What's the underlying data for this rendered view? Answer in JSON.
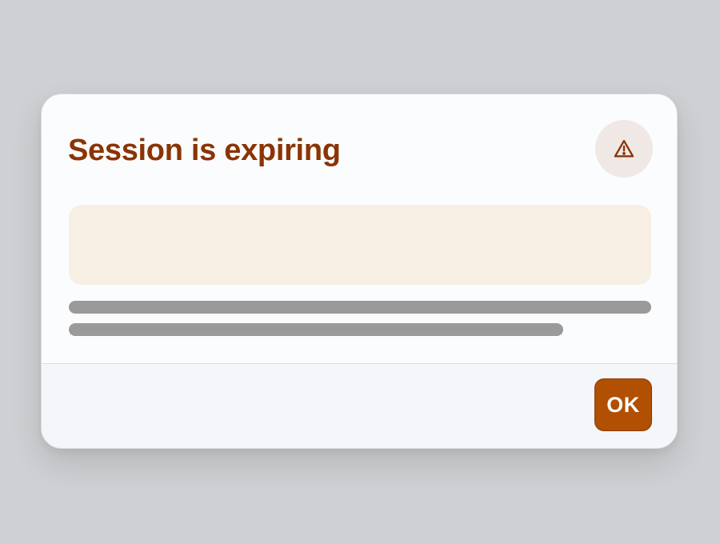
{
  "dialog": {
    "title": "Session is expiring",
    "icon": "warning-triangle-icon",
    "ok_label": "OK"
  },
  "colors": {
    "title": "#8a3406",
    "accent_button": "#b14f02",
    "notice_panel": "#f8efe4",
    "icon_badge": "#efe8e5",
    "skeleton": "#9a9a9a"
  }
}
